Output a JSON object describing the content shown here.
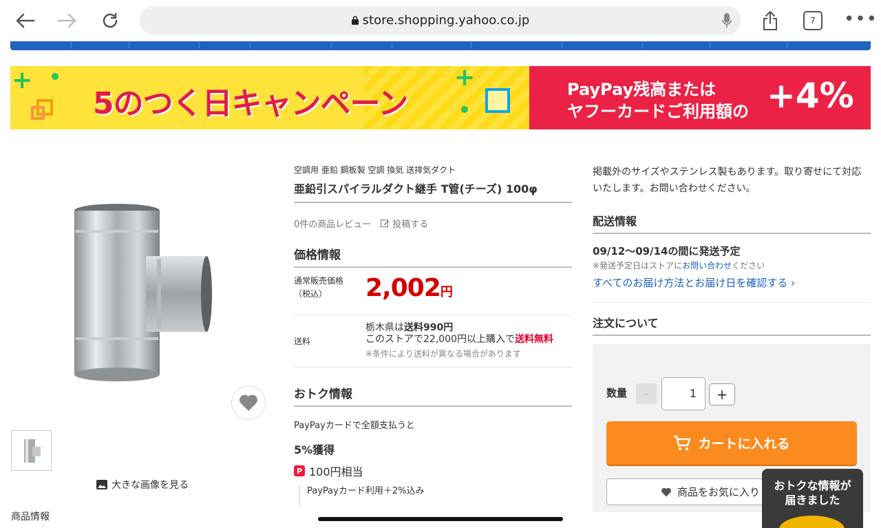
{
  "browser": {
    "url": "store.shopping.yahoo.co.jp",
    "tab_count": "7"
  },
  "banner": {
    "left_text": "5のつく日キャンペーン",
    "right_line1": "PayPay残高または",
    "right_line2": "ヤフーカードご利用額の",
    "right_pct": "+4%"
  },
  "gallery": {
    "view_large": "大きな画像を見る",
    "cut_text": "商品情報"
  },
  "product": {
    "breadcrumb": "空調用 亜鉛 鋼板製 空調 換気 送排気ダクト",
    "title": "亜鉛引スパイラルダクト継手 T管(チーズ) 100φ",
    "review_count": "0件の商品レビュー",
    "review_post": "投稿する"
  },
  "price": {
    "section_title": "価格情報",
    "label": "通常販売価格\n（税込）",
    "label_line1": "通常販売価格",
    "label_line2": "（税込）",
    "value": "2,002",
    "unit": "円"
  },
  "shipping": {
    "label": "送料",
    "line1_prefix": "栃木県は",
    "line1_bold": "送料990円",
    "line2_prefix": "このストアで22,000円以上購入で",
    "line2_red": "送料無料",
    "note": "※条件により送料が異なる場合があります"
  },
  "deals": {
    "section_title": "おトク情報",
    "pay_text": "PayPayカードで全額支払うと",
    "pct_get": "5%獲得",
    "yen_equiv": "100円相当",
    "pp_icon": "P",
    "pp_note": "PayPayカード利用＋2%込み"
  },
  "right": {
    "info_text": "掲載外のサイズやステンレス製もあります。取り寄せにて対応いたします。お問い合わせください。",
    "delivery_title": "配送情報",
    "ship_date": "09/12〜09/14の間に発送予定",
    "ship_note_prefix": "※発送予定日はストアに",
    "ship_note_link": "お問い合わせ",
    "ship_note_suffix": "ください",
    "all_methods": "すべてのお届け方法とお届け日を確認する",
    "order_title": "注文について",
    "qty_label": "数量",
    "qty_minus": "-",
    "qty_value": "1",
    "qty_plus": "+",
    "cart_button": "カートに入れる",
    "fav_button": "商品をお気に入り"
  },
  "notification": {
    "line1": "おトクな情報が",
    "line2": "届きました"
  },
  "colors": {
    "price_red": "#d20000",
    "link_blue": "#1b5fc1",
    "cart_orange": "#fb8b1e",
    "banner_yellow": "#ffe33b",
    "banner_red": "#eb2245",
    "nav_blue": "#1f63c0"
  }
}
